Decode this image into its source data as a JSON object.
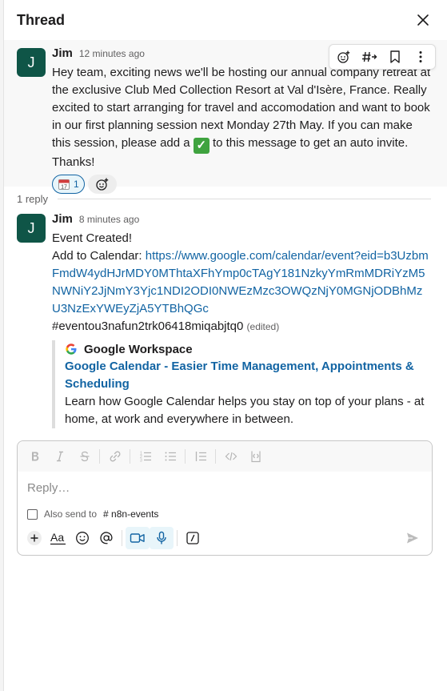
{
  "header": {
    "title": "Thread"
  },
  "parent": {
    "avatar_letter": "J",
    "author": "Jim",
    "time": "12 minutes ago",
    "text_before": "Hey team, exciting news we'll be hosting our annual company retreat at the exclusive Club Med Collection Resort at Val d'Isère, France. Really excited to start arranging for travel and accomodation and want to book in our first planning session next Monday 27th May. If you can make this session, please add a ",
    "emoji_check": "✓",
    "text_after": " to this message to get an auto invite. Thanks!",
    "reaction": {
      "emoji": "calendar",
      "count": "1"
    },
    "toolbar_icons": [
      "add-reaction-icon",
      "reply-in-thread-icon",
      "bookmark-icon",
      "more-icon"
    ]
  },
  "replies_label": "1 reply",
  "reply": {
    "avatar_letter": "J",
    "author": "Jim",
    "time": "8 minutes ago",
    "line1": "Event Created!",
    "line2_prefix": "Add to Calendar: ",
    "link": "https://www.google.com/calendar/event?eid=b3UzbmFmdW4ydHJrMDY0MThtaXFhYmp0cTAgY181NzkyYmRmMDRiYzM5NWNiY2JjNmY3Yjc1NDI2ODI0NWEzMzc3OWQzNjY0MGNjODBhMzU3NzExYWEyZjA5YTBhQGc",
    "event_id": "#eventou3nafun2trk06418miqabjtq0",
    "edited": "(edited)",
    "attachment": {
      "service": "Google Workspace",
      "title": "Google Calendar - Easier Time Management, Appointments & Scheduling",
      "description": "Learn how Google Calendar helps you stay on top of your plans - at home, at work and everywhere in between."
    }
  },
  "composer": {
    "placeholder": "Reply…",
    "also_send_label": "Also send to",
    "channel": "# n8n-events",
    "format_icons": [
      "bold-icon",
      "italic-icon",
      "strikethrough-icon",
      "link-icon",
      "ordered-list-icon",
      "bulleted-list-icon",
      "blockquote-icon",
      "code-icon",
      "code-block-icon"
    ],
    "action_icons": [
      "plus-icon",
      "formatting-icon",
      "emoji-icon",
      "mention-icon",
      "video-icon",
      "microphone-icon",
      "slash-command-icon",
      "send-icon"
    ]
  },
  "colors": {
    "accent": "#1264a3",
    "avatar": "#0f5547",
    "check": "#3fa33f"
  }
}
